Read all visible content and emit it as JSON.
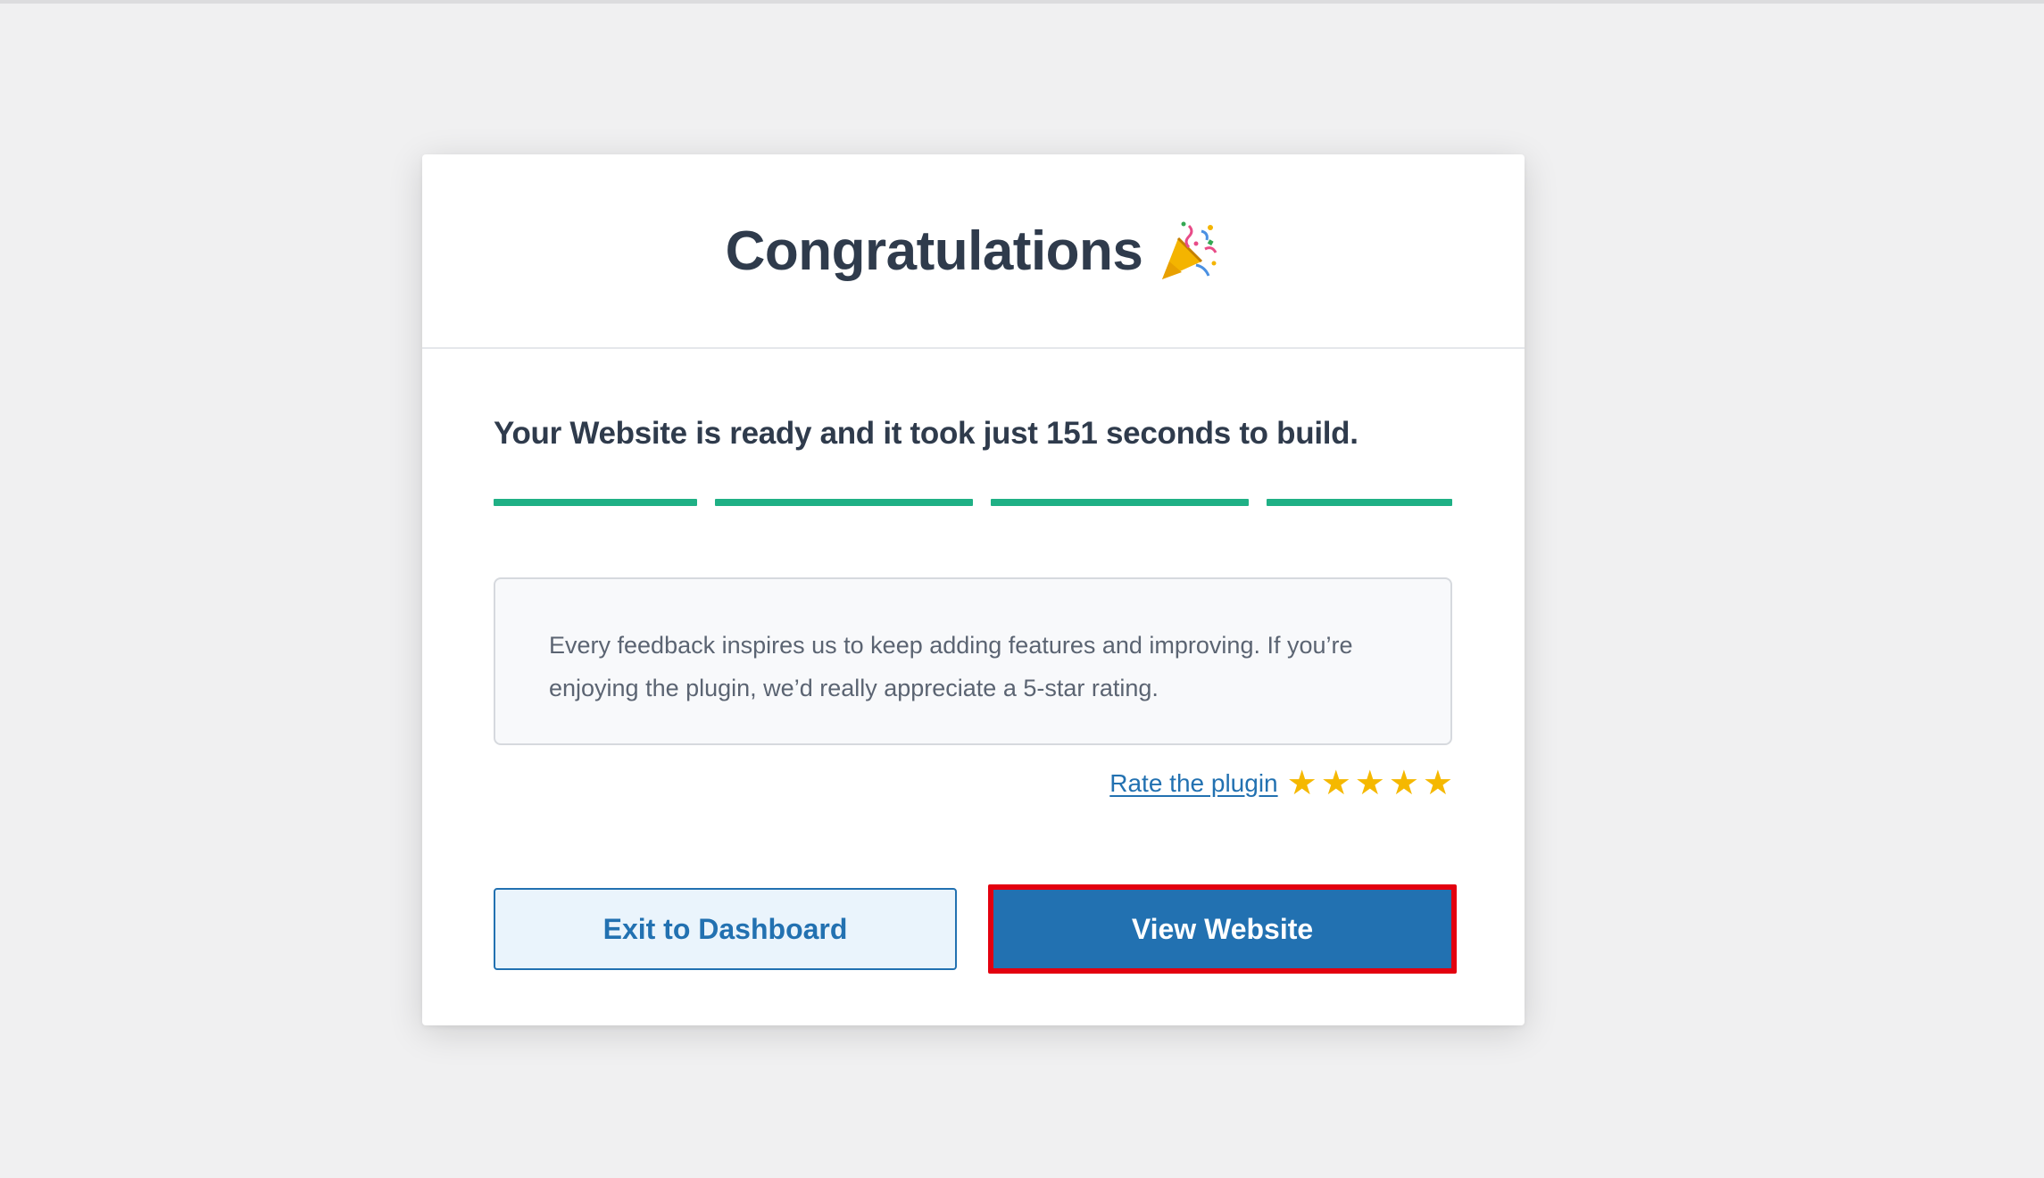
{
  "modal": {
    "title": "Congratulations",
    "title_icon": "party-popper-icon",
    "ready_message": "Your Website is ready and it took just 151 seconds to build.",
    "progress": {
      "steps_total": 4,
      "steps_complete": 4,
      "color": "#1fb085"
    },
    "feedback_text": "Every feedback inspires us to keep adding features and improving. If you’re enjoying the plugin, we’d really appreciate a 5-star rating.",
    "rate_link": "Rate the plugin",
    "stars": 5,
    "exit_button": "Exit to Dashboard",
    "view_button": "View Website"
  },
  "colors": {
    "primary": "#2271b1",
    "highlight_border": "#e3000f",
    "star": "#f5b800",
    "text_dark": "#2f3b4c"
  }
}
